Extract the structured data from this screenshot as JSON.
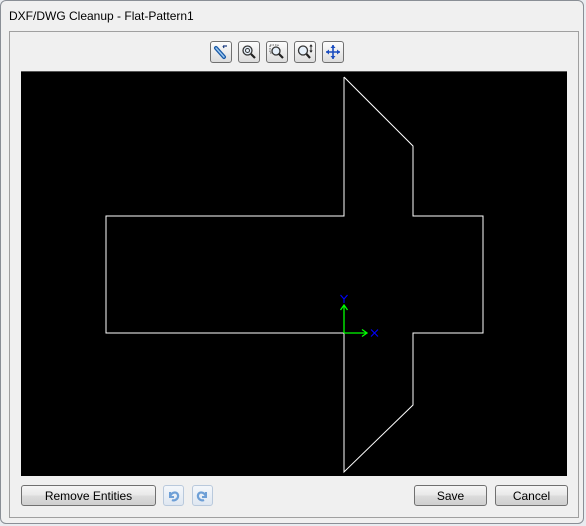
{
  "window": {
    "title": "DXF/DWG Cleanup - Flat-Pattern1"
  },
  "toolbar": {
    "tools": [
      {
        "name": "select-tool",
        "icon": "wand-select-icon"
      },
      {
        "name": "zoom-fit",
        "icon": "zoom-fit-icon"
      },
      {
        "name": "zoom-area",
        "icon": "zoom-area-icon"
      },
      {
        "name": "zoom-in-out",
        "icon": "zoom-in-out-icon"
      },
      {
        "name": "pan",
        "icon": "pan-icon"
      }
    ]
  },
  "canvas": {
    "background": "#000000",
    "line_color": "#ffffff",
    "axis": {
      "x_label": "X",
      "y_label": "Y",
      "arrow_color": "#00ff00",
      "label_color": "#0000ff"
    }
  },
  "footer": {
    "remove_entities_label": "Remove Entities",
    "undo_icon": "undo-icon",
    "redo_icon": "redo-icon",
    "save_label": "Save",
    "cancel_label": "Cancel"
  }
}
